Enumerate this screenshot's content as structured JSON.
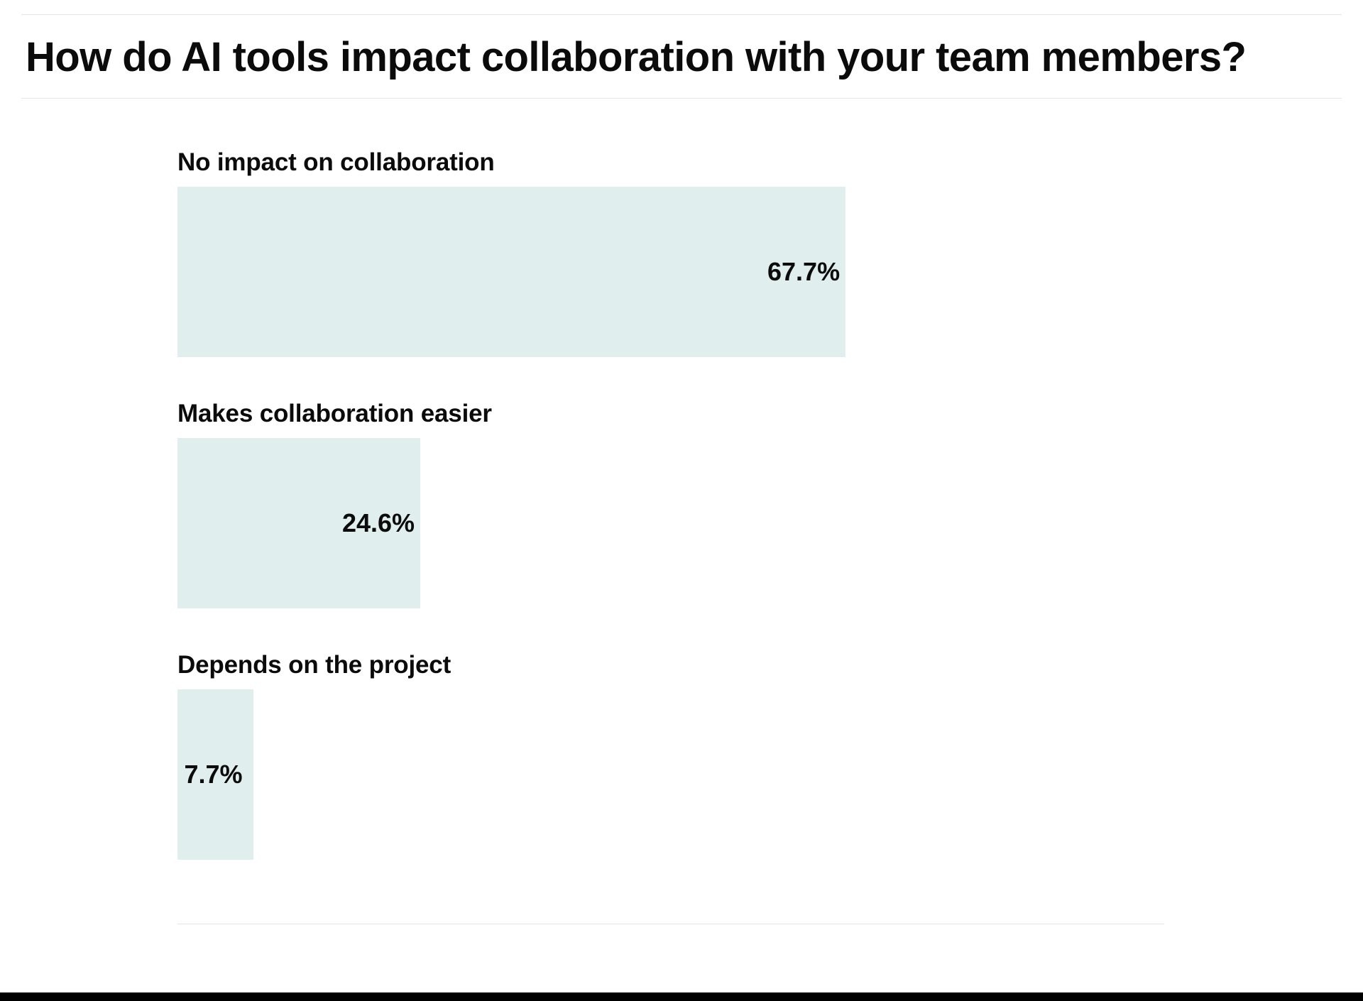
{
  "title": "How do AI tools impact collaboration with your team members?",
  "colors": {
    "bar_fill": "#e0eeed",
    "text": "#0b0b0b",
    "rule": "#e5e5e5"
  },
  "chart_data": {
    "type": "bar",
    "orientation": "horizontal",
    "title": "How do AI tools impact collaboration with your team members?",
    "xlabel": "",
    "ylabel": "",
    "xlim": [
      0,
      100
    ],
    "categories": [
      "No impact on collaboration",
      "Makes collaboration easier",
      "Depends on the project"
    ],
    "values": [
      67.7,
      24.6,
      7.7
    ],
    "value_labels": [
      "67.7%",
      "24.6%",
      "7.7%"
    ],
    "legend": false
  }
}
